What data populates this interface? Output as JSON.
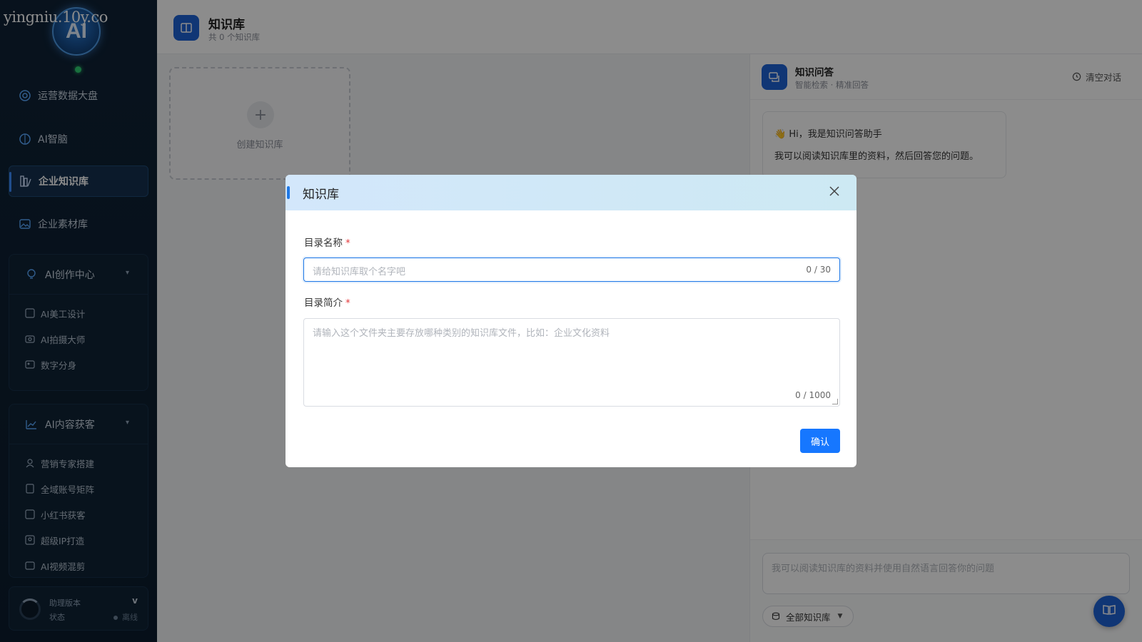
{
  "watermark": "yingniu.10y.co",
  "logo_text": "AI",
  "sidebar": {
    "items": [
      {
        "label": "运营数据大盘",
        "icon": "dashboard-icon"
      },
      {
        "label": "AI智脑",
        "icon": "brain-icon"
      },
      {
        "label": "企业知识库",
        "icon": "library-icon",
        "active": true
      },
      {
        "label": "企业素材库",
        "icon": "image-icon"
      }
    ],
    "groups": [
      {
        "title": "AI创作中心",
        "icon": "bulb-icon",
        "items": [
          "AI美工设计",
          "AI拍摄大师",
          "数字分身"
        ]
      },
      {
        "title": "AI内容获客",
        "icon": "trend-icon",
        "items": [
          "营销专家搭建",
          "全域账号矩阵",
          "小红书获客",
          "超级IP打造",
          "AI视频混剪"
        ]
      }
    ],
    "bottom": {
      "line1": "助理版本",
      "line2": "状态",
      "version": "v",
      "status": "离线"
    }
  },
  "header": {
    "title": "知识库",
    "count_text": "共 0 个知识库"
  },
  "create_card": {
    "label": "创建知识库"
  },
  "chat": {
    "title": "知识问答",
    "subtitle": "智能检索 · 精准回答",
    "clear_label": "清空对话",
    "greeting_line1": "👋 Hi，我是知识问答助手",
    "greeting_line2": "我可以阅读知识库里的资料，然后回答您的问题。",
    "input_placeholder": "我可以阅读知识库的资料并使用自然语言回答你的问题",
    "kb_select": "全部知识库"
  },
  "modal": {
    "title": "知识库",
    "name_label": "目录名称",
    "name_placeholder": "请给知识库取个名字吧",
    "name_counter": "0 / 30",
    "desc_label": "目录简介",
    "desc_placeholder": "请输入这个文件夹主要存放哪种类别的知识库文件，比如：企业文化资料",
    "desc_counter": "0 / 1000",
    "required_mark": "*",
    "confirm_label": "确认"
  },
  "colors": {
    "primary": "#1677ff",
    "sidebar_bg": "#0f2236",
    "accent_blue": "#1e63d6",
    "required": "#e4393c"
  }
}
